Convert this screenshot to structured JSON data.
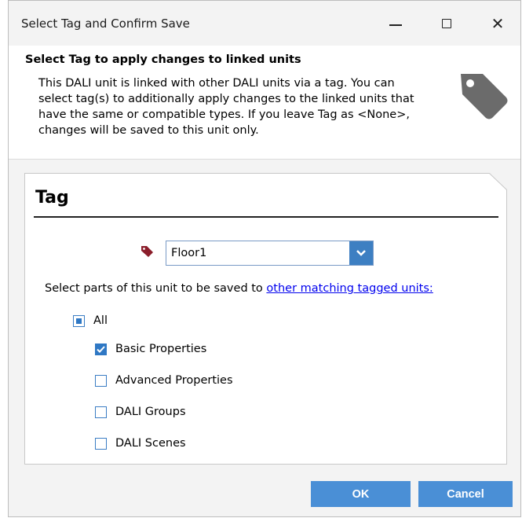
{
  "window": {
    "title": "Select Tag and Confirm Save",
    "controls": {
      "minimize": "minimize-icon",
      "maximize": "maximize-icon",
      "close": "close-icon"
    }
  },
  "header": {
    "title": "Select Tag to apply changes to linked units",
    "description": "This DALI unit is linked with other DALI units via a tag. You can select tag(s) to additionally apply changes to the linked units that have the same or compatible types. If you leave Tag as <None>, changes will be saved to this unit only.",
    "icon": "tag-icon"
  },
  "panel": {
    "title": "Tag",
    "tag_dropdown": {
      "value": "Floor1",
      "icon": "tag-icon",
      "tag_color": "#8b1e2b"
    },
    "select_text": "Select parts of this unit to be saved to ",
    "select_link": "other matching tagged units:",
    "checkboxes": [
      {
        "label": "All",
        "state": "partial"
      },
      {
        "label": "Basic Properties",
        "state": "checked"
      },
      {
        "label": "Advanced Properties",
        "state": "unchecked"
      },
      {
        "label": "DALI Groups",
        "state": "unchecked"
      },
      {
        "label": "DALI Scenes",
        "state": "unchecked"
      }
    ]
  },
  "buttons": {
    "ok": "OK",
    "cancel": "Cancel"
  },
  "colors": {
    "accent": "#4a8fd6",
    "checkbox": "#2f78c4",
    "link": "#0000ee"
  }
}
